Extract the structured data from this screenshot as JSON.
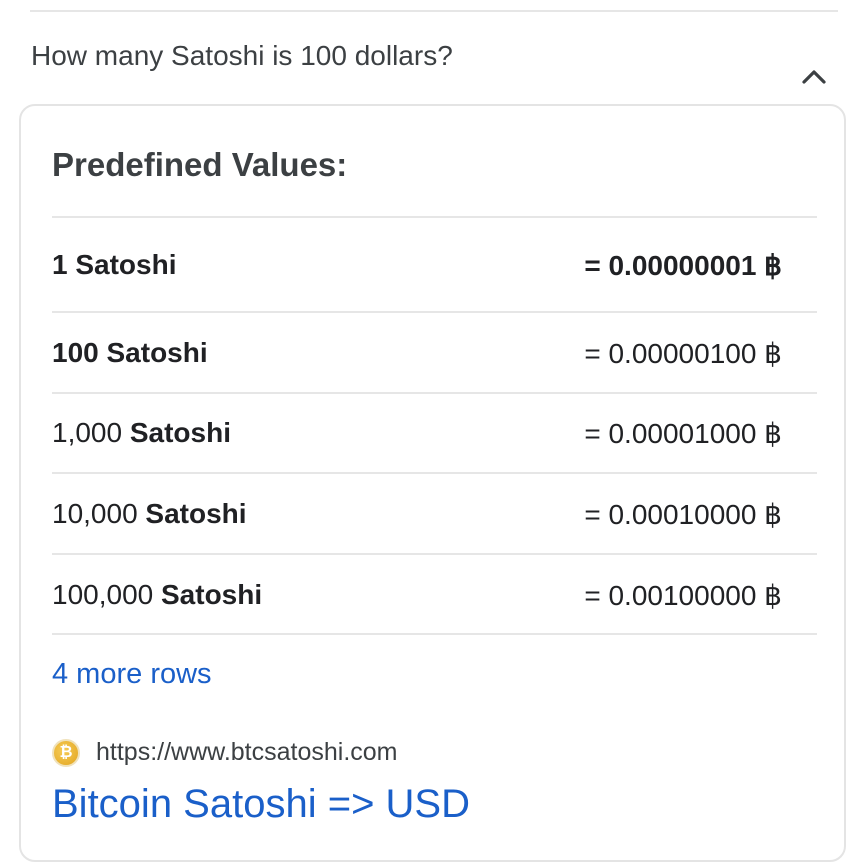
{
  "faq": {
    "question": "How many Satoshi is 100 dollars?",
    "expanded_icon": "chevron-up-icon"
  },
  "card": {
    "title": "Predefined Values:",
    "rows": [
      {
        "amount": "1",
        "unit": "Satoshi",
        "value": "= 0.00000001 ฿",
        "bold_label": true,
        "bold_value": true
      },
      {
        "amount": "100",
        "unit": "Satoshi",
        "value": "= 0.00000100 ฿",
        "bold_label": true,
        "bold_value": false
      },
      {
        "amount": "1,000",
        "unit": "Satoshi",
        "value": "= 0.00001000 ฿",
        "bold_label": false,
        "bold_value": false
      },
      {
        "amount": "10,000",
        "unit": "Satoshi",
        "value": "= 0.00010000 ฿",
        "bold_label": false,
        "bold_value": false
      },
      {
        "amount": "100,000",
        "unit": "Satoshi",
        "value": "= 0.00100000 ฿",
        "bold_label": false,
        "bold_value": false
      }
    ],
    "more_rows": "4 more rows",
    "source": {
      "favicon": "bitcoin-icon",
      "favicon_glyph": "₿",
      "url": "https://www.btcsatoshi.com",
      "link_title": "Bitcoin Satoshi => USD"
    }
  },
  "colors": {
    "link": "#1a5fc9",
    "text": "#202124",
    "divider": "#e6e6e6",
    "favicon": "#e2a41f"
  }
}
